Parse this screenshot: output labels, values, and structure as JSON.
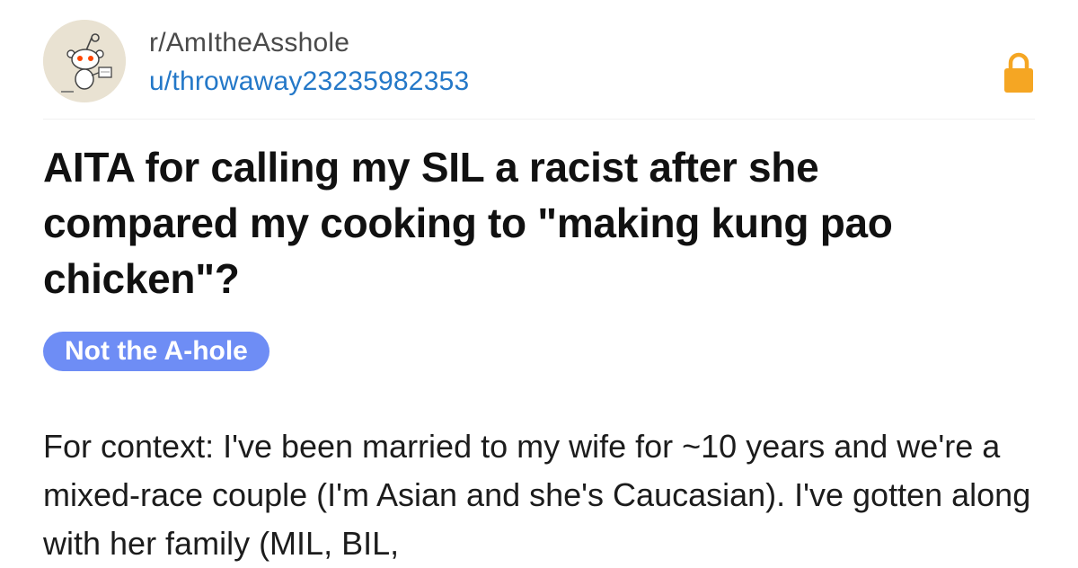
{
  "post": {
    "subreddit": "r/AmItheAsshole",
    "username": "u/throwaway23235982353",
    "title": "AITA for calling my SIL a racist after she compared my cooking to \"making kung pao chicken\"?",
    "flair": "Not the A-hole",
    "body": "For context: I've been married to my wife for ~10 years and we're a mixed-race couple (I'm Asian and she's Caucasian). I've gotten along with her family (MIL, BIL,"
  },
  "icons": {
    "avatar": "reddit-snoo-avatar",
    "lock": "lock-icon"
  },
  "colors": {
    "username": "#2478c8",
    "flair_bg": "#6e8df5",
    "lock": "#f5a623"
  }
}
